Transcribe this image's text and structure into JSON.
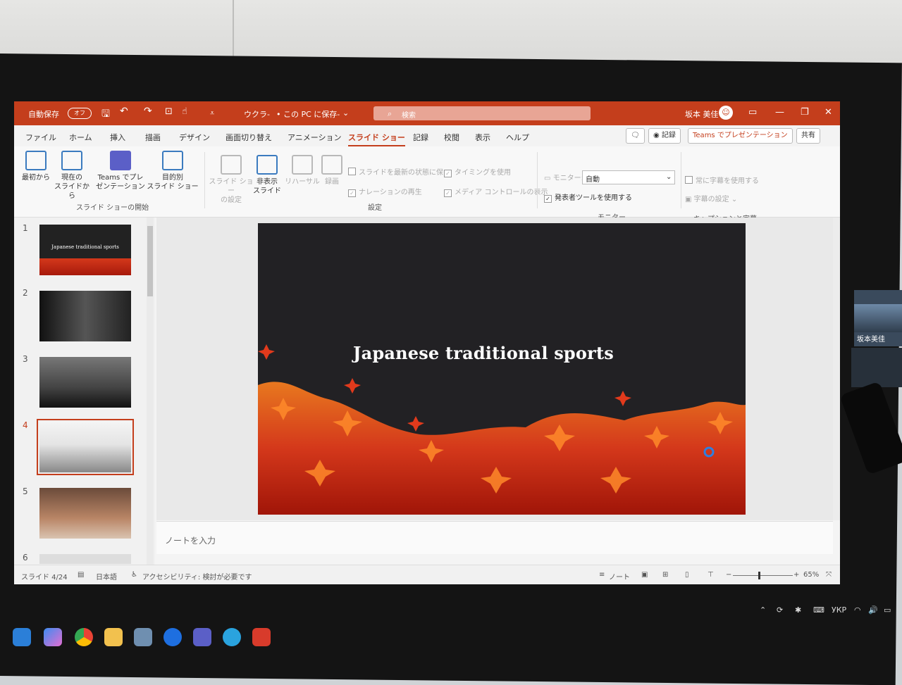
{
  "titlebar": {
    "autosave": "自動保存",
    "autosave_state": "オフ",
    "filename": "ウクラ-",
    "save_location": "• この PC に保存-",
    "search_placeholder": "検索",
    "user": "坂本 美佳"
  },
  "tabs": [
    "ファイル",
    "ホーム",
    "挿入",
    "描画",
    "デザイン",
    "画面切り替え",
    "アニメーション",
    "スライド ショー",
    "記録",
    "校閲",
    "表示",
    "ヘルプ"
  ],
  "active_tab": "スライド ショー",
  "ribbon": {
    "buttons": [
      {
        "label": "最初から",
        "icon": "play-from-start-icon"
      },
      {
        "label": "現在の\nスライドから",
        "icon": "play-current-icon"
      },
      {
        "label": "Teams でプレ\nゼンテーション",
        "icon": "teams-icon"
      },
      {
        "label": "目的別\nスライド ショー",
        "icon": "custom-show-icon"
      },
      {
        "label": "スライド ショー\nの設定",
        "icon": "setup-show-icon"
      },
      {
        "label": "非表示\nスライド",
        "icon": "hide-slide-icon"
      },
      {
        "label": "リハーサル",
        "icon": "rehearse-icon"
      },
      {
        "label": "録画",
        "icon": "record-icon"
      }
    ],
    "group_start": "スライド ショーの開始",
    "group_settings": "設定",
    "group_monitor": "モニター",
    "group_captions": "キャプションと字幕",
    "checks": [
      {
        "label": "スライドを最新の状態に保つ",
        "checked": false
      },
      {
        "label": "ナレーションの再生",
        "checked": true
      },
      {
        "label": "タイミングを使用",
        "checked": true
      },
      {
        "label": "メディア コントロールの表示",
        "checked": true
      },
      {
        "label": "発表者ツールを使用する",
        "checked": true
      },
      {
        "label": "常に字幕を使用する",
        "checked": false
      }
    ],
    "monitor_label": "モニター:",
    "monitor_value": "自動",
    "subtitle_settings": "字幕の設定",
    "record_btn": "記録",
    "teams_btn": "Teams でプレゼンテーション",
    "share_btn": "共有"
  },
  "thumbnails": [
    "1",
    "2",
    "3",
    "4",
    "5",
    "6"
  ],
  "current_slide": "4",
  "thumb1_title": "Japanese traditional sports",
  "slide": {
    "title": "Japanese traditional sports"
  },
  "notes_placeholder": "ノートを入力",
  "status": {
    "slide_indicator": "スライド 4/24",
    "language": "日本語",
    "accessibility": "アクセシビリティ: 検討が必要です",
    "notes": "ノート",
    "zoom": "65%"
  },
  "meeting": {
    "participant": "坂本美佳"
  },
  "tray": {
    "lang": "УКР"
  },
  "colors": {
    "accent": "#c43e1c",
    "leaf_red": "#d4381b",
    "leaf_orange": "#e8781f",
    "slide_bg": "#222124"
  }
}
